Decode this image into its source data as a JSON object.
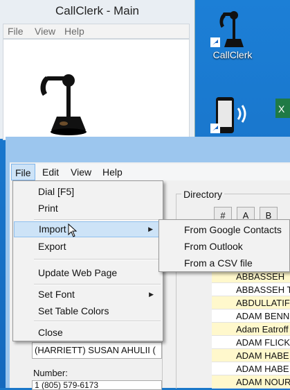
{
  "background_window": {
    "title": "CallClerk - Main",
    "menu": [
      "File",
      "View",
      "Help"
    ]
  },
  "desktop_icons": [
    {
      "label": "CallClerk",
      "icon": "candlestick-phone-icon"
    },
    {
      "label": "",
      "icon": "mobile-phone-icon"
    },
    {
      "label": "",
      "icon": "excel-icon"
    }
  ],
  "window": {
    "menu": [
      "File",
      "Edit",
      "View",
      "Help"
    ]
  },
  "file_menu": {
    "items": [
      "Dial [F5]",
      "Print",
      "Import",
      "Export",
      "Update Web Page",
      "Set Font",
      "Set Table Colors",
      "Close"
    ]
  },
  "import_submenu": {
    "items": [
      "From Google Contacts",
      "From Outlook",
      "From a CSV file"
    ]
  },
  "directory": {
    "label": "Directory",
    "tabs": [
      "#",
      "A",
      "B"
    ],
    "rows": [
      {
        "name": "ABBASSEH",
        "color": "yellow"
      },
      {
        "name": "ABBASSEH T",
        "color": "white"
      },
      {
        "name": "ABDULLATIF",
        "color": "yellow"
      },
      {
        "name": "ADAM BENN",
        "color": "white"
      },
      {
        "name": "Adam Eatroff",
        "color": "yellow"
      },
      {
        "name": "ADAM FLICK",
        "color": "white"
      },
      {
        "name": "ADAM HABE",
        "color": "yellow"
      },
      {
        "name": "ADAM HABE",
        "color": "white"
      },
      {
        "name": "ADAM NOUR",
        "color": "yellow"
      }
    ]
  },
  "contact": {
    "name_value": "(HARRIETT) SUSAN AHULII (",
    "number_label": "Number:",
    "number_value": "1 (805) 579-6173"
  },
  "colors": {
    "row_yellow": "#fff8cc",
    "menu_highlight": "#cde3f7",
    "desktop_blue": "#1a77c9"
  }
}
